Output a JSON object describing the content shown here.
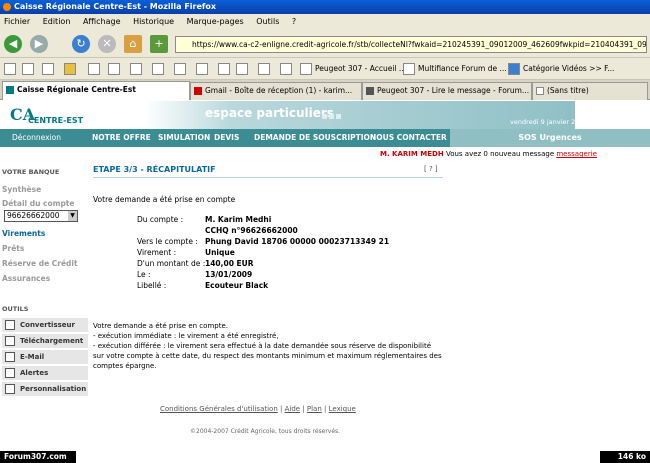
{
  "window": {
    "title": "Caisse Régionale Centre-Est - Mozilla Firefox"
  },
  "menu": [
    "Fichier",
    "Edition",
    "Affichage",
    "Historique",
    "Marque-pages",
    "Outils",
    "?"
  ],
  "address": {
    "url": "https://www.ca-c2-enligne.credit-agricole.fr/stb/collecteNI?fwkaid=210245391_09012009_462609fwkpid=210404391_09012009"
  },
  "bookmarks": [
    {
      "label": "Peugeot 307 - Accueil ..."
    },
    {
      "label": "Multifiance Forum de ..."
    },
    {
      "label": "Catégorie Vidéos >> F..."
    }
  ],
  "tabs": [
    {
      "label": "Caisse Régionale Centre-Est"
    },
    {
      "label": "Gmail - Boîte de réception (1) - karim..."
    },
    {
      "label": "Peugeot 307 - Lire le message - Forum..."
    },
    {
      "label": "(Sans titre)"
    }
  ],
  "header": {
    "brand": "CA",
    "brand_sub": "CENTRE-EST",
    "espace": "espace particuliers",
    "date": "vendredi 9 janvier 2009"
  },
  "nav": {
    "items": [
      "Déconnexion",
      "NOTRE OFFRE",
      "SIMULATION",
      "DEVIS",
      "DEMANDE DE SOUSCRIPTION",
      "NOUS CONTACTER"
    ],
    "urgence": "SOS Urgences"
  },
  "user": {
    "name": "M. KARIM MEDH",
    "message": "Vous avez 0 nouveau message",
    "link": "messagerie"
  },
  "sidebar": {
    "section1": "VOTRE BANQUE",
    "items": [
      "Synthèse",
      "Détail du compte",
      "Virements",
      "Prêts",
      "Réserve de Crédit",
      "Assurances"
    ],
    "account": "96626662000",
    "section2": "OUTILS",
    "tools": [
      "Convertisseur",
      "Téléchargement",
      "E-Mail",
      "Alertes",
      "Personnalisation"
    ]
  },
  "content": {
    "step": "ETAPE 3/3 - RÉCAPITULATIF",
    "help": "[ ? ]",
    "intro": "Votre demande a été prise en compte",
    "details": [
      {
        "label": "Du compte :",
        "value": "M. Karim Medhi"
      },
      {
        "label": "",
        "value": "CCHQ n°96626662000"
      },
      {
        "label": "Vers le compte :",
        "value": "Phung David 18706 00000 00023713349 21"
      },
      {
        "label": "Virement :",
        "value": "Unique"
      },
      {
        "label": "D'un montant de :",
        "value": "140,00 EUR"
      },
      {
        "label": "Le :",
        "value": "13/01/2009"
      },
      {
        "label": "Libellé :",
        "value": "Ecouteur Black"
      }
    ],
    "note": [
      "Votre demande a été prise en compte.",
      "- exécution immédiate : le virement a été enregistré,",
      "- exécution différée : le virement sera effectué à la date demandée sous réserve de disponibilité",
      "sur votre compte à cette date, du respect des montants minimum et maximum réglementaires des",
      "comptes épargne."
    ]
  },
  "footer": {
    "links": [
      "Conditions Générales d'utilisation",
      "Aide",
      "Plan",
      "Lexique"
    ],
    "copyright": "©2004-2007 Crédit Agricole, tous droits réservés."
  },
  "status": {
    "watermark": "Forum307.com",
    "size": "146 ko"
  },
  "colors": {
    "teal": "#3c8c94",
    "brand": "#007a87",
    "link": "#0a67a0"
  }
}
